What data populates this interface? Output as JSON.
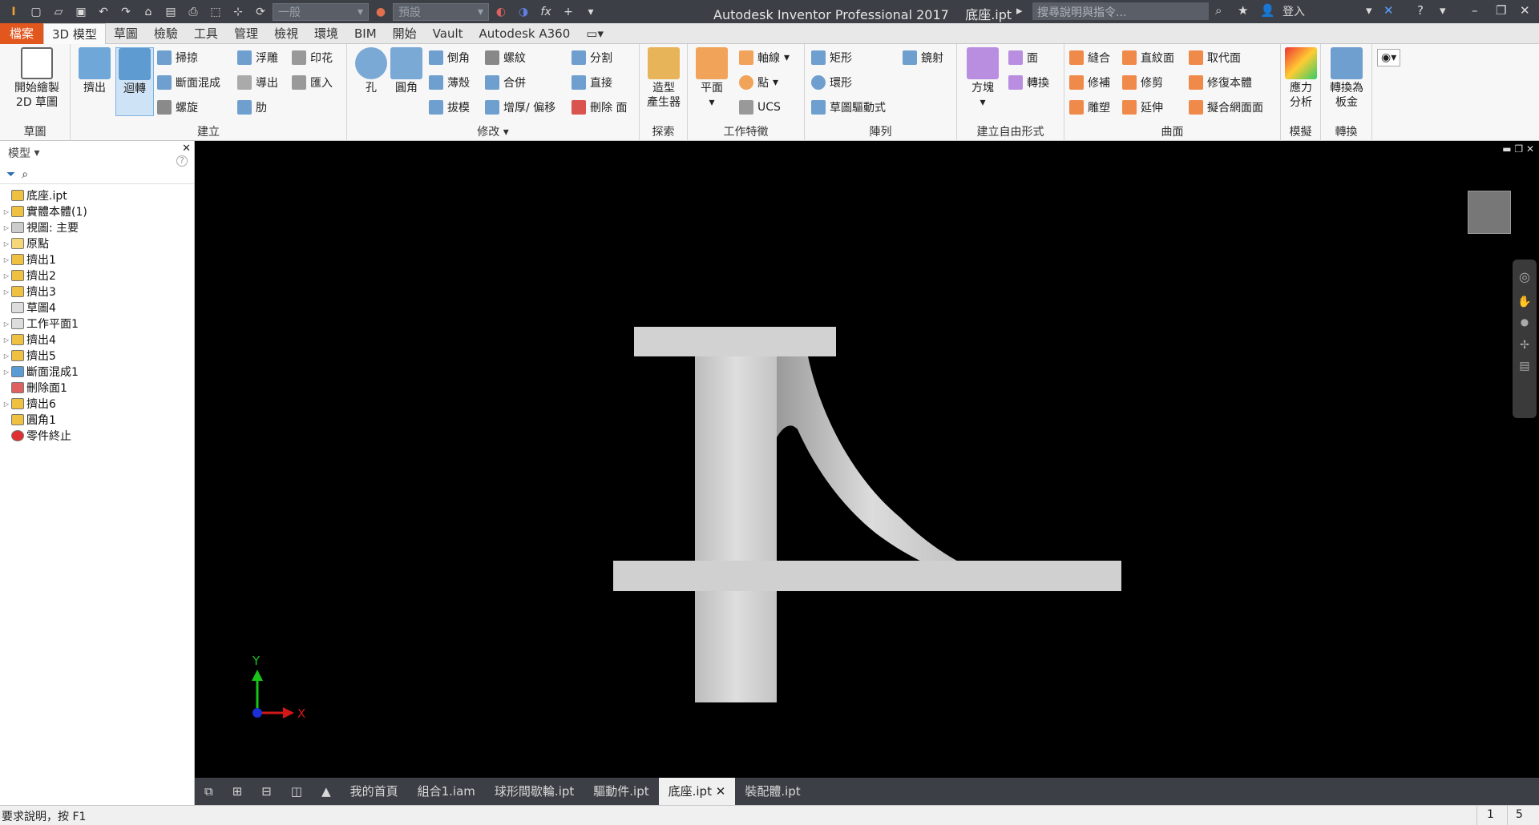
{
  "titlebar": {
    "app_title": "Autodesk Inventor Professional 2017",
    "file_name": "底座.ipt",
    "appearance_select": "一般",
    "material_select": "預設",
    "search_placeholder": "搜尋說明與指令...",
    "login_label": "登入"
  },
  "menu": {
    "tabs": [
      "檔案",
      "3D 模型",
      "草圖",
      "檢驗",
      "工具",
      "管理",
      "檢視",
      "環境",
      "BIM",
      "開始",
      "Vault",
      "Autodesk A360"
    ]
  },
  "ribbon": {
    "sketch": {
      "title": "草圖",
      "start_sketch": "開始繪製",
      "sketch_2d": "2D 草圖"
    },
    "create": {
      "title": "建立",
      "extrude": "擠出",
      "revolve": "迴轉",
      "sweep": "掃掠",
      "loft": "斷面混成",
      "coil": "螺旋",
      "emboss": "浮雕",
      "derive": "導出",
      "rib": "肋",
      "decal": "印花",
      "import": "匯入"
    },
    "modify": {
      "title": "修改",
      "hole": "孔",
      "fillet": "圓角",
      "chamfer": "倒角",
      "shell": "薄殼",
      "draft": "拔模",
      "thread": "螺紋",
      "combine": "合併",
      "thicken": "增厚/ 偏移",
      "split": "分割",
      "direct": "直接",
      "delete_face": "刪除 面"
    },
    "explore": {
      "title": "探索",
      "shape_generator_1": "造型",
      "shape_generator_2": "產生器"
    },
    "work_features": {
      "title": "工作特徵",
      "plane": "平面",
      "axis": "軸線",
      "point": "點",
      "ucs": "UCS"
    },
    "pattern": {
      "title": "陣列",
      "rectangular": "矩形",
      "circular": "環形",
      "sketch_driven": "草圖驅動式",
      "mirror": "鏡射"
    },
    "freeform": {
      "title": "建立自由形式",
      "box": "方塊",
      "face": "面",
      "convert": "轉換"
    },
    "surface": {
      "title": "曲面",
      "stitch": "縫合",
      "patch": "修補",
      "sculpt": "雕塑",
      "ruled": "直紋面",
      "trim": "修剪",
      "extend": "延伸",
      "replace": "取代面",
      "repair": "修復本體",
      "fit_mesh": "擬合網面面"
    },
    "simulation": {
      "title": "模擬",
      "stress_1": "應力",
      "stress_2": "分析"
    },
    "convert": {
      "title": "轉換",
      "sheet_metal_1": "轉換為",
      "sheet_metal_2": "板金"
    }
  },
  "browser": {
    "header": "模型",
    "items": [
      {
        "label": "底座.ipt",
        "expander": false,
        "icon": "part-icon"
      },
      {
        "label": "實體本體(1)",
        "expander": true,
        "icon": "solid-bodies-icon"
      },
      {
        "label": "視圖: 主要",
        "expander": true,
        "icon": "view-icon"
      },
      {
        "label": "原點",
        "expander": true,
        "icon": "folder-icon"
      },
      {
        "label": "擠出1",
        "expander": true,
        "icon": "extrude-icon"
      },
      {
        "label": "擠出2",
        "expander": true,
        "icon": "extrude-icon"
      },
      {
        "label": "擠出3",
        "expander": true,
        "icon": "extrude-icon"
      },
      {
        "label": "草圖4",
        "expander": false,
        "icon": "sketch-icon"
      },
      {
        "label": "工作平面1",
        "expander": true,
        "icon": "workplane-icon"
      },
      {
        "label": "擠出4",
        "expander": true,
        "icon": "extrude-icon"
      },
      {
        "label": "擠出5",
        "expander": true,
        "icon": "extrude-icon"
      },
      {
        "label": "斷面混成1",
        "expander": true,
        "icon": "loft-icon"
      },
      {
        "label": "刪除面1",
        "expander": false,
        "icon": "delete-face-icon"
      },
      {
        "label": "擠出6",
        "expander": true,
        "icon": "extrude-icon"
      },
      {
        "label": "圓角1",
        "expander": false,
        "icon": "fillet-icon"
      },
      {
        "label": "零件終止",
        "expander": false,
        "icon": "end-of-part-icon"
      }
    ]
  },
  "viewport": {
    "axis_y": "Y",
    "axis_x": "X"
  },
  "doc_tabs": [
    "我的首頁",
    "組合1.iam",
    "球形間歇輪.ipt",
    "驅動件.ipt",
    "底座.ipt",
    "裝配體.ipt"
  ],
  "status": {
    "help_text": "要求說明，按 F1",
    "count_1": "1",
    "count_2": "5"
  },
  "colors": {
    "accent": "#e2571e",
    "titlebar": "#3c3f45",
    "viewport_bg": "#000000",
    "model_gray": "#d6d6d6"
  }
}
